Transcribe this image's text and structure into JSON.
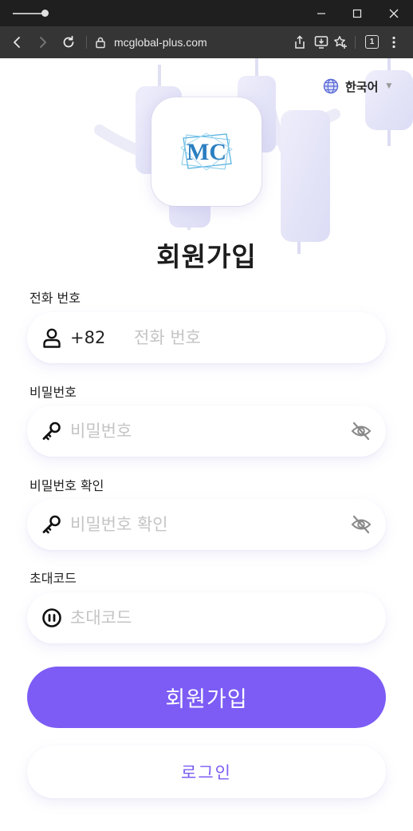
{
  "browser": {
    "url": "mcglobal-plus.com",
    "tab_count": "1"
  },
  "header": {
    "language": "한국어",
    "logo_text": "MC"
  },
  "form": {
    "title": "회원가입",
    "phone": {
      "label": "전화 번호",
      "prefix": "+82",
      "placeholder": "전화 번호"
    },
    "password": {
      "label": "비밀번호",
      "placeholder": "비밀번호"
    },
    "confirm_password": {
      "label": "비밀번호 확인",
      "placeholder": "비밀번호 확인"
    },
    "invite_code": {
      "label": "초대코드",
      "placeholder": "초대코드"
    },
    "submit_label": "회원가입",
    "login_label": "로그인"
  },
  "colors": {
    "accent": "#7c5cf5",
    "window_bar": "#1f1f1f",
    "address_bar": "#353535"
  }
}
